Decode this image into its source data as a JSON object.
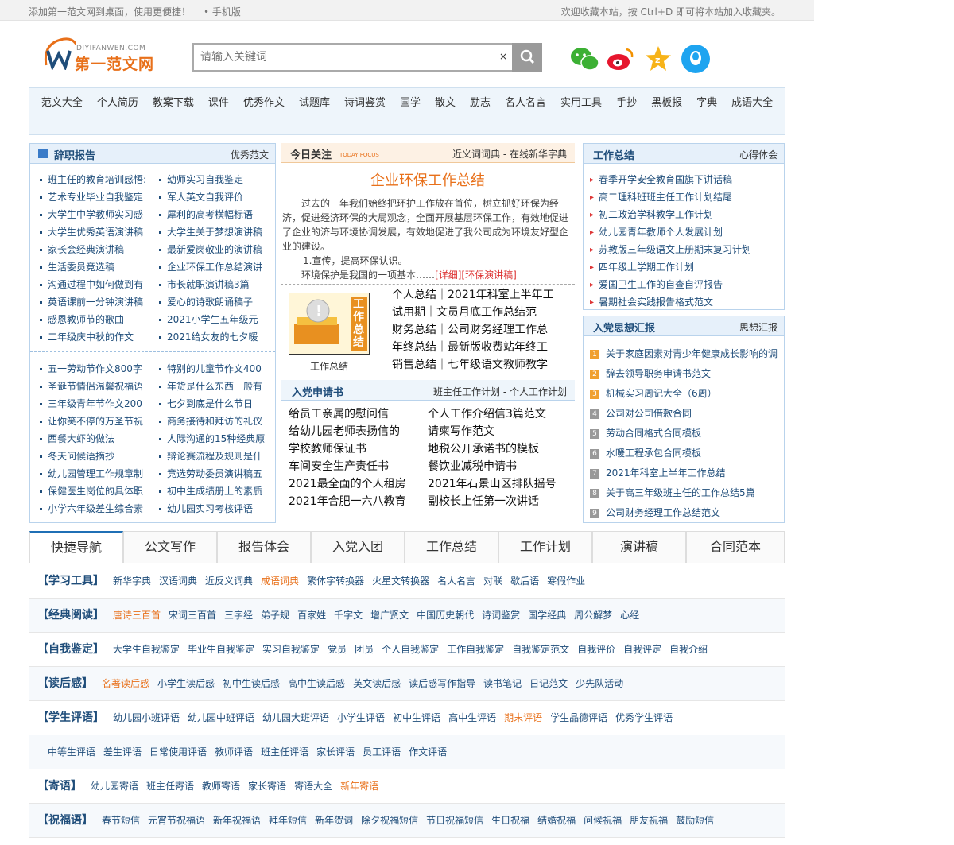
{
  "topbar": {
    "left": "添加第一范文网到桌面，使用更便捷！",
    "mobile": "• 手机版",
    "right": "欢迎收藏本站，按 Ctrl+D 即可将本站加入收藏夹。"
  },
  "logo": {
    "en": "DIYIFANWEN.COM",
    "cn": "第一范文网"
  },
  "search": {
    "placeholder": "请输入关键词",
    "clear": "×"
  },
  "colors": {
    "accent": "#1f4d7a",
    "orange": "#e8701a"
  },
  "nav": [
    "范文大全",
    "个人简历",
    "教案下载",
    "课件",
    "优秀作文",
    "试题库",
    "诗词鉴赏",
    "国学",
    "散文",
    "励志",
    "名人名言",
    "实用工具",
    "手抄",
    "黑板报",
    "字典",
    "成语大全"
  ],
  "ci": {
    "title": "辞职报告",
    "more": "优秀范文",
    "col1": [
      "班主任的教育培训感悟:",
      "艺术专业毕业自我鉴定",
      "大学生中学教师实习感",
      "大学生优秀英语演讲稿",
      "家长会经典演讲稿",
      "生活委员竞选稿",
      "沟通过程中如何做到有",
      "英语课前一分钟演讲稿",
      "感恩教师节的歌曲",
      "二年级庆中秋的作文"
    ],
    "col2": [
      "幼师实习自我鉴定",
      "军人英文自我评价",
      "犀利的高考横幅标语",
      "大学生关于梦想演讲稿",
      "最新爱岗敬业的演讲稿",
      "企业环保工作总结演讲",
      "市长就职演讲稿3篇",
      "爱心的诗歌朗诵稿子",
      "2021小学生五年级元",
      "2021给女友的七夕暖"
    ],
    "col3": [
      "五一劳动节作文800字",
      "圣诞节情侣温馨祝福语",
      "三年级青年节作文200",
      "让你笑不停的万圣节祝",
      "西餐大虾的做法",
      "冬天问候语摘抄",
      "幼儿园管理工作规章制",
      "保健医生岗位的具体职",
      "小学六年级差生综合素"
    ],
    "col4": [
      "特别的儿童节作文400",
      "年货是什么东西一般有",
      "七夕到底是什么节日",
      "商务接待和拜访的礼仪",
      "人际沟通的15种经典原",
      "辩论赛流程及规则是什",
      "竞选劳动委员演讲稿五",
      "初中生成绩册上的素质",
      "幼儿园实习考核评语"
    ]
  },
  "today": {
    "title": "今日关注",
    "sub": "TODAY FOCUS",
    "links": "近义词词典 - 在线新华字典",
    "headline": "企业环保工作总结",
    "para": "过去的一年我们始终把环护工作放在首位，树立抓好环保为经济，促进经济环保的大局观念，全面开展基层环保工作，有效地促进了企业的济与环境协调发展，有效地促进了我公司成为环境友好型企业的建设。",
    "p2": "1.宣传，提高环保认识。",
    "p3": "环境保护是我国的一项基本……",
    "more": "[详细]",
    "tag": "[环保演讲稿]",
    "img_text": "工作总结",
    "img_caption": "工作总结",
    "items": [
      "个人总结｜2021年科室上半年工",
      "试用期｜文员月底工作总结范",
      "财务总结｜公司财务经理工作总",
      "年终总结｜最新版收费站年终工",
      "销售总结｜七年级语文教师教学"
    ]
  },
  "rudang": {
    "title": "入党申请书",
    "more": "班主任工作计划 - 个人工作计划",
    "col1": [
      "给员工亲属的慰问信",
      "给幼儿园老师表扬信的",
      "学校教师保证书",
      "车间安全生产责任书",
      "2021最全面的个人租房",
      "2021年合肥一六八教育"
    ],
    "col2": [
      "个人工作介绍信3篇范文",
      "请柬写作范文",
      "地税公开承诺书的模板",
      "餐饮业减税申请书",
      "2021年石景山区排队摇号",
      "副校长上任第一次讲话"
    ]
  },
  "gz": {
    "title": "工作总结",
    "more": "心得体会",
    "items": [
      "春季开学安全教育国旗下讲话稿",
      "高二理科班班主任工作计划结尾",
      "初二政治学科教学工作计划",
      "幼儿园青年教师个人发展计划",
      "苏教版三年级语文上册期末复习计划",
      "四年级上学期工作计划",
      "爱国卫生工作的自查自评报告",
      "暑期社会实践报告格式范文"
    ]
  },
  "rd": {
    "title": "入党思想汇报",
    "more": "思想汇报",
    "items": [
      "关于家庭因素对青少年健康成长影响的调",
      "辞去领导职务申请书范文",
      "机械实习周记大全（6周）",
      "公司对公司借款合同",
      "劳动合同格式合同模板",
      "水暖工程承包合同模板",
      "2021年科室上半年工作总结",
      "关于高三年级班主任的工作总结5篇",
      "公司财务经理工作总结范文"
    ]
  },
  "tabs": [
    "快捷导航",
    "公文写作",
    "报告体会",
    "入党入团",
    "工作总结",
    "工作计划",
    "演讲稿",
    "合同范本"
  ],
  "rows": [
    {
      "k": "【学习工具】",
      "items": [
        "新华字典",
        "汉语词典",
        "近反义词典",
        "成语词典",
        "繁体字转换器",
        "火星文转换器",
        "名人名言",
        "对联",
        "歇后语",
        "寒假作业"
      ],
      "hl": [
        3
      ]
    },
    {
      "k": "【经典阅读】",
      "items": [
        "唐诗三百首",
        "宋词三百首",
        "三字经",
        "弟子规",
        "百家姓",
        "千字文",
        "增广贤文",
        "中国历史朝代",
        "诗词鉴赏",
        "国学经典",
        "周公解梦",
        "心经"
      ],
      "hl": [
        0
      ]
    },
    {
      "k": "【自我鉴定】",
      "items": [
        "大学生自我鉴定",
        "毕业生自我鉴定",
        "实习自我鉴定",
        "党员",
        "团员",
        "个人自我鉴定",
        "工作自我鉴定",
        "自我鉴定范文",
        "自我评价",
        "自我评定",
        "自我介绍"
      ],
      "hl": []
    },
    {
      "k": "【读后感】",
      "items": [
        "名著读后感",
        "小学生读后感",
        "初中生读后感",
        "高中生读后感",
        "英文读后感",
        "读后感写作指导",
        "读书笔记",
        "日记范文",
        "少先队活动"
      ],
      "hl": [
        0
      ]
    },
    {
      "k": "【学生评语】",
      "items": [
        "幼儿园小班评语",
        "幼儿园中班评语",
        "幼儿园大班评语",
        "小学生评语",
        "初中生评语",
        "高中生评语",
        "期末评语",
        "学生品德评语",
        "优秀学生评语"
      ],
      "hl": [
        6
      ]
    },
    {
      "k": "",
      "items": [
        "中等生评语",
        "差生评语",
        "日常使用评语",
        "教师评语",
        "班主任评语",
        "家长评语",
        "员工评语",
        "作文评语"
      ],
      "hl": []
    },
    {
      "k": "【寄语】",
      "items": [
        "幼儿园寄语",
        "班主任寄语",
        "教师寄语",
        "家长寄语",
        "寄语大全",
        "新年寄语"
      ],
      "hl": [
        5
      ]
    },
    {
      "k": "【祝福语】",
      "items": [
        "春节短信",
        "元宵节祝福语",
        "新年祝福语",
        "拜年短信",
        "新年贺词",
        "除夕祝福短信",
        "节日祝福短信",
        "生日祝福",
        "结婚祝福",
        "问候祝福",
        "朋友祝福",
        "鼓励短信"
      ],
      "hl": []
    }
  ]
}
